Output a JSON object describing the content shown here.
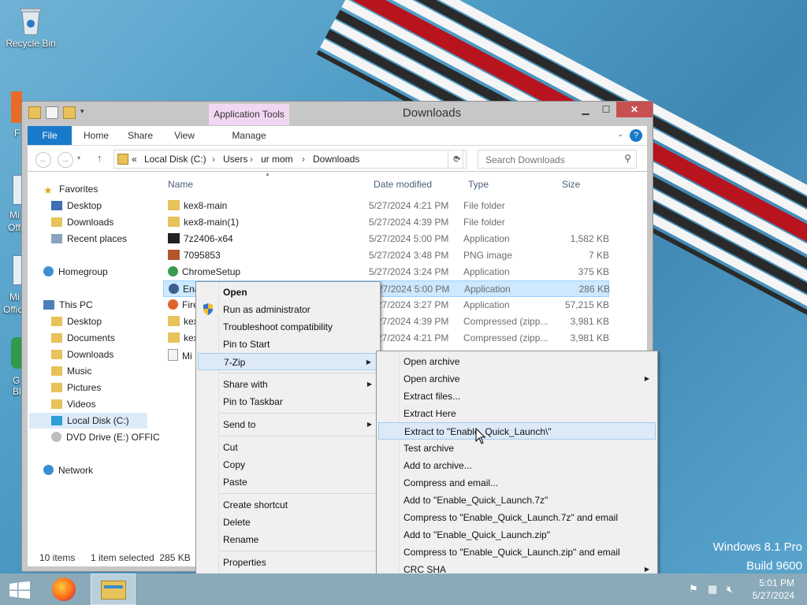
{
  "desktop": {
    "recycle_bin": "Recycle Bin",
    "side_labels": [
      "F",
      "Mi",
      "Offi",
      "Mi",
      "Offic",
      "G",
      "Bl"
    ],
    "watermark_line1": "Windows 8.1 Pro",
    "watermark_line2": "Build 9600"
  },
  "window": {
    "title": "Downloads",
    "app_tools": "Application Tools",
    "ribbon_tabs": [
      "File",
      "Home",
      "Share",
      "View",
      "Manage"
    ],
    "help": "?"
  },
  "address": {
    "crumbs": [
      "«",
      "Local Disk (C:)",
      "Users",
      "ur mom",
      "Downloads"
    ],
    "search_placeholder": "Search Downloads"
  },
  "nav": {
    "favorites": "Favorites",
    "fav_items": [
      "Desktop",
      "Downloads",
      "Recent places"
    ],
    "homegroup": "Homegroup",
    "this_pc": "This PC",
    "pc_items": [
      "Desktop",
      "Documents",
      "Downloads",
      "Music",
      "Pictures",
      "Videos",
      "Local Disk (C:)",
      "DVD Drive (E:) OFFIC"
    ],
    "network": "Network"
  },
  "columns": [
    "Name",
    "Date modified",
    "Type",
    "Size"
  ],
  "files": [
    {
      "name": "kex8-main",
      "date": "5/27/2024 4:21 PM",
      "type": "File folder",
      "size": ""
    },
    {
      "name": "kex8-main(1)",
      "date": "5/27/2024 4:39 PM",
      "type": "File folder",
      "size": ""
    },
    {
      "name": "7z2406-x64",
      "date": "5/27/2024 5:00 PM",
      "type": "Application",
      "size": "1,582 KB"
    },
    {
      "name": "7095853",
      "date": "5/27/2024 3:48 PM",
      "type": "PNG image",
      "size": "7 KB"
    },
    {
      "name": "ChromeSetup",
      "date": "5/27/2024 3:24 PM",
      "type": "Application",
      "size": "375 KB"
    },
    {
      "name": "Ena",
      "date": "5/27/2024 5:00 PM",
      "type": "Application",
      "size": "286 KB"
    },
    {
      "name": "Fire",
      "date": "5/27/2024 3:27 PM",
      "type": "Application",
      "size": "57,215 KB"
    },
    {
      "name": "kex",
      "date": "5/27/2024 4:39 PM",
      "type": "Compressed (zipp...",
      "size": "3,981 KB"
    },
    {
      "name": "kex",
      "date": "5/27/2024 4:21 PM",
      "type": "Compressed (zipp...",
      "size": "3,981 KB"
    },
    {
      "name": "Mi",
      "date": "",
      "type": "",
      "size": ""
    }
  ],
  "status": {
    "items": "10 items",
    "selected": "1 item selected  285 KB"
  },
  "context_menu": {
    "items": [
      "Open",
      "Run as administrator",
      "Troubleshoot compatibility",
      "Pin to Start",
      "7-Zip",
      "Share with",
      "Pin to Taskbar",
      "Send to",
      "Cut",
      "Copy",
      "Paste",
      "Create shortcut",
      "Delete",
      "Rename",
      "Properties"
    ]
  },
  "zip_menu": {
    "items": [
      "Open archive",
      "Open archive",
      "Extract files...",
      "Extract Here",
      "Extract to \"Enable_Quick_Launch\\\"",
      "Test archive",
      "Add to archive...",
      "Compress and email...",
      "Add to \"Enable_Quick_Launch.7z\"",
      "Compress to \"Enable_Quick_Launch.7z\" and email",
      "Add to \"Enable_Quick_Launch.zip\"",
      "Compress to \"Enable_Quick_Launch.zip\" and email",
      "CRC SHA"
    ]
  },
  "taskbar": {
    "time": "5:01 PM",
    "date": "5/27/2024"
  }
}
